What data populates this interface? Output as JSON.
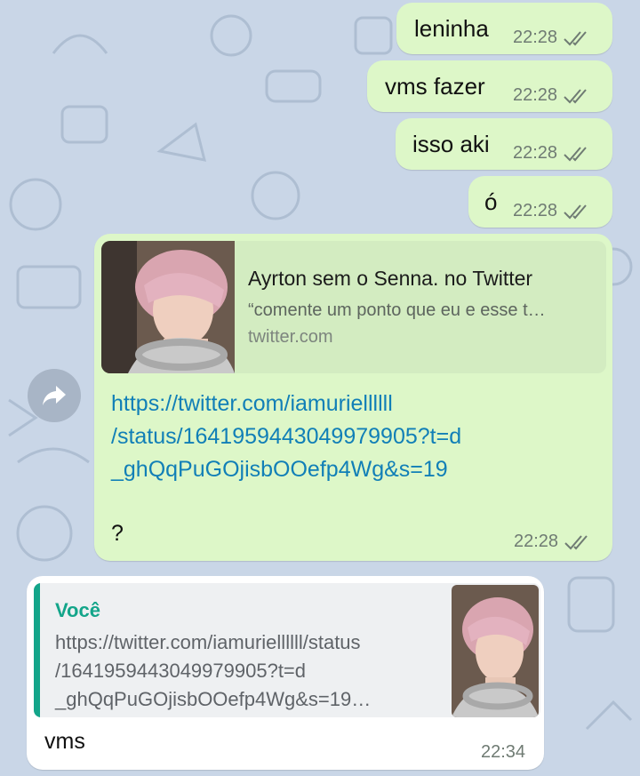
{
  "colors": {
    "outgoing_bubble": "#ddf7c8",
    "incoming_bubble": "#ffffff",
    "link": "#117fb7",
    "quote_accent": "#13a58a",
    "wallpaper": "#c9d6e7"
  },
  "messages": [
    {
      "text": "leninha",
      "time": "22:28",
      "status": "read"
    },
    {
      "text": "vms fazer",
      "time": "22:28",
      "status": "read"
    },
    {
      "text": "isso aki",
      "time": "22:28",
      "status": "read"
    },
    {
      "text": "ó",
      "time": "22:28",
      "status": "read"
    }
  ],
  "link_message": {
    "preview": {
      "title": "Ayrton sem o Senna. no Twitter",
      "description": "“comente um ponto que eu e esse t…",
      "domain": "twitter.com"
    },
    "url_lines": [
      "https://twitter.com/iamuriellllll",
      "/status/1641959443049979905?t=d",
      "_ghQqPuGOjisbOOefp4Wg&s=19"
    ],
    "extra_text": "?",
    "time": "22:28",
    "status": "read",
    "forward_icon": "share-arrow-icon"
  },
  "reply_message": {
    "quote": {
      "author": "Você",
      "lines": [
        "https://twitter.com/iamuriellllll/status",
        "/1641959443049979905?t=d",
        "_ghQqPuGOjisbOOefp4Wg&s=19…"
      ]
    },
    "text": "vms",
    "time": "22:34"
  }
}
